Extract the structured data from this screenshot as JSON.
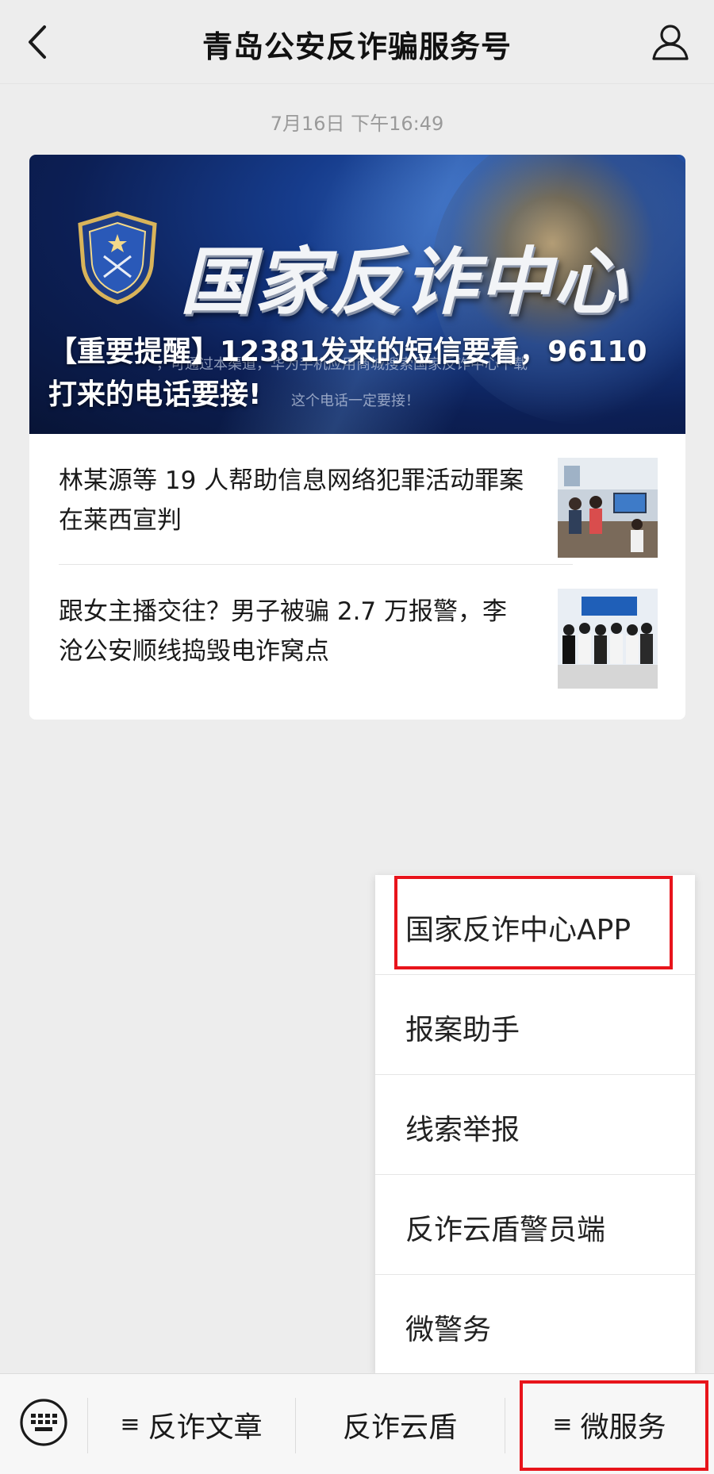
{
  "header": {
    "title": "青岛公安反诈骗服务号",
    "back_icon": "chevron-left-icon",
    "profile_icon": "person-icon"
  },
  "timestamp": "7月16日 下午16:49",
  "banner": {
    "big_title": "国家反诈中心",
    "emblem_text": "国家反诈中心",
    "headline": "【重要提醒】12381发来的短信要看，96110打来的电话要接!",
    "faint_line1": "，可通过本渠道，华为手机应用商城搜索国家反诈中心下载",
    "faint_line2": "这个电话一定要接！"
  },
  "articles": [
    {
      "title": "林某源等 19 人帮助信息网络犯罪活动罪案在莱西宣判",
      "thumb": "courtroom-photo"
    },
    {
      "title": "跟女主播交往？男子被骗 2.7 万报警，李沧公安顺线捣毁电诈窝点",
      "thumb": "suspects-lineup-photo"
    }
  ],
  "menu": {
    "items": [
      "国家反诈中心APP",
      "报案助手",
      "线索举报",
      "反诈云盾警员端",
      "微警务"
    ]
  },
  "bottom_bar": {
    "keyboard_icon": "keyboard-icon",
    "tabs": [
      {
        "label": "反诈文章",
        "has_menu_icon": true
      },
      {
        "label": "反诈云盾",
        "has_menu_icon": false
      },
      {
        "label": "微服务",
        "has_menu_icon": true
      }
    ],
    "menu_glyph": "≡"
  },
  "colors": {
    "highlight": "#e8141b",
    "background": "#ededed",
    "banner_blue": "#163c8c"
  }
}
